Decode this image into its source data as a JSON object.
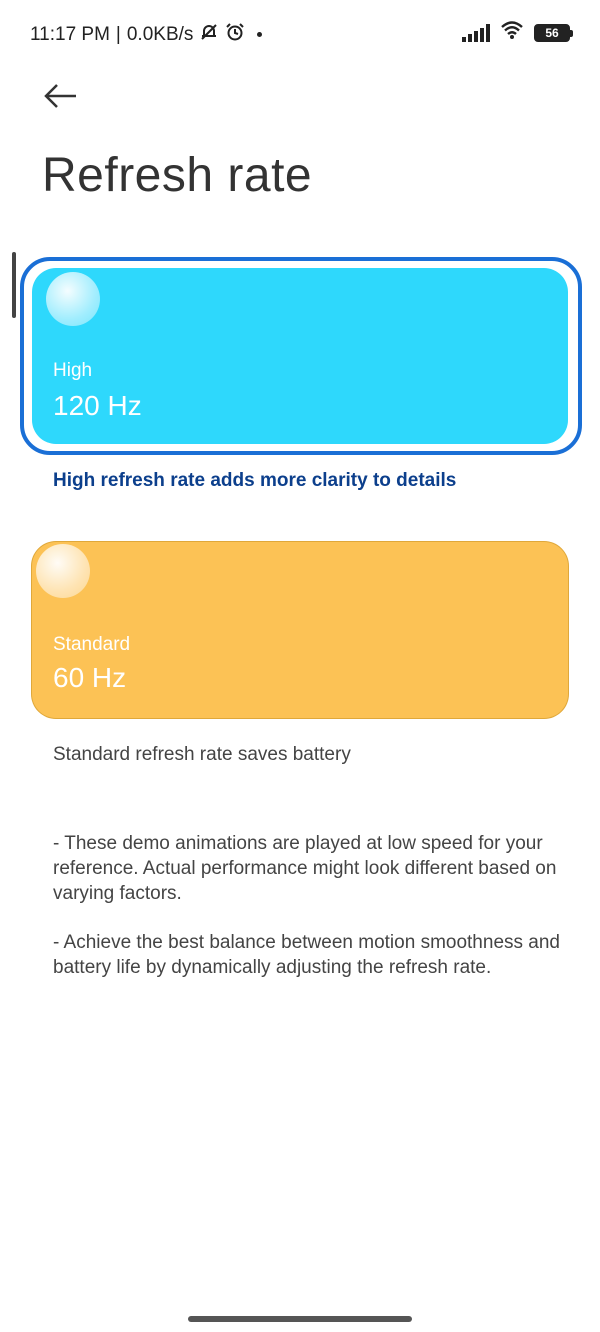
{
  "status_bar": {
    "time": "11:17 PM",
    "separator": "|",
    "network_speed": "0.0KB/s",
    "battery_level": "56",
    "icons": [
      "mute-bell-icon",
      "alarm-icon",
      "dot-icon",
      "signal-icon",
      "wifi-icon",
      "battery-icon"
    ]
  },
  "header": {
    "back_icon": "arrow-left-icon",
    "title": "Refresh rate"
  },
  "options": [
    {
      "label": "High",
      "value": "120 Hz",
      "description": "High refresh rate adds more clarity to details",
      "color": "#2ed8fc",
      "selected": true
    },
    {
      "label": "Standard",
      "value": "60 Hz",
      "description": "Standard refresh rate saves battery",
      "color": "#fcc255",
      "selected": false
    }
  ],
  "notes": [
    "- These demo animations are played at low speed for your reference. Actual performance might look different based on varying factors.",
    "- Achieve the best balance between motion smoothness and battery life by dynamically adjusting the refresh rate."
  ],
  "colors": {
    "selection_outline": "#1a6fd6",
    "selected_description": "#0c3f8c"
  }
}
